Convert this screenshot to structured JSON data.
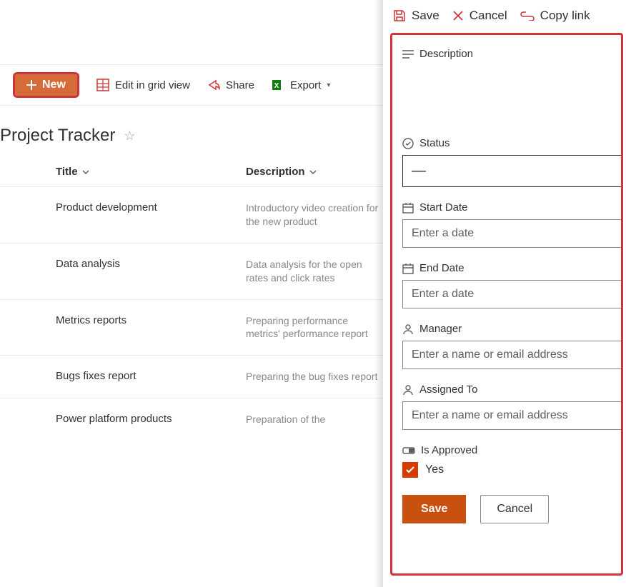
{
  "toolbar": {
    "new_label": "New",
    "edit_grid_label": "Edit in grid view",
    "share_label": "Share",
    "export_label": "Export"
  },
  "list": {
    "title": "Project Tracker",
    "columns": {
      "title": "Title",
      "description": "Description"
    },
    "rows": [
      {
        "title": "Product development",
        "description": "Introductory video creation for the new product"
      },
      {
        "title": "Data analysis",
        "description": "Data analysis for the open rates and click rates"
      },
      {
        "title": "Metrics reports",
        "description": "Preparing performance metrics' performance report"
      },
      {
        "title": "Bugs fixes report",
        "description": "Preparing the bug fixes report"
      },
      {
        "title": "Power platform products",
        "description": "Preparation of the"
      }
    ]
  },
  "panel": {
    "top": {
      "save": "Save",
      "cancel": "Cancel",
      "copy_link": "Copy link"
    },
    "fields": {
      "description_label": "Description",
      "status_label": "Status",
      "status_value": "—",
      "start_date_label": "Start Date",
      "start_date_placeholder": "Enter a date",
      "end_date_label": "End Date",
      "end_date_placeholder": "Enter a date",
      "manager_label": "Manager",
      "manager_placeholder": "Enter a name or email address",
      "assigned_to_label": "Assigned To",
      "assigned_to_placeholder": "Enter a name or email address",
      "is_approved_label": "Is Approved",
      "is_approved_value": "Yes"
    },
    "buttons": {
      "save": "Save",
      "cancel": "Cancel"
    }
  }
}
